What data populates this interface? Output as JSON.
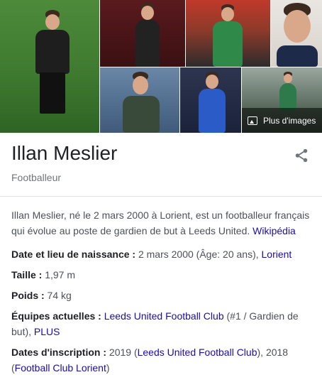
{
  "gallery": {
    "more_images_label": "Plus d'images"
  },
  "header": {
    "title": "Illan Meslier",
    "subtitle": "Footballeur"
  },
  "description": {
    "text": "Illan Meslier, né le 2 mars 2000 à Lorient, est un footballeur français qui évolue au poste de gardien de but à Leeds United. ",
    "source_link": "Wikipédia"
  },
  "facts": {
    "birth": {
      "label": "Date et lieu de naissance :",
      "value": " 2 mars 2000 (Âge: 20 ans), ",
      "link": "Lorient"
    },
    "height": {
      "label": "Taille :",
      "value": " 1,97 m"
    },
    "weight": {
      "label": "Poids :",
      "value": " 74 kg"
    },
    "teams": {
      "label": "Équipes actuelles :",
      "link": "Leeds United Football Club",
      "value": " (#1 / Gardien de but), ",
      "more": "PLUS"
    },
    "registration": {
      "label": "Dates d'inscription :",
      "value1": " 2019 (",
      "link1": "Leeds United Football Club",
      "value2": "), 2018 (",
      "link2": "Football Club Lorient",
      "value3": ")"
    }
  },
  "colors": {
    "link": "#1a0dab",
    "text": "#4d5156",
    "title": "#202124",
    "subtle": "#70757a"
  },
  "icons": {
    "share": "share-icon",
    "image": "image-icon"
  }
}
